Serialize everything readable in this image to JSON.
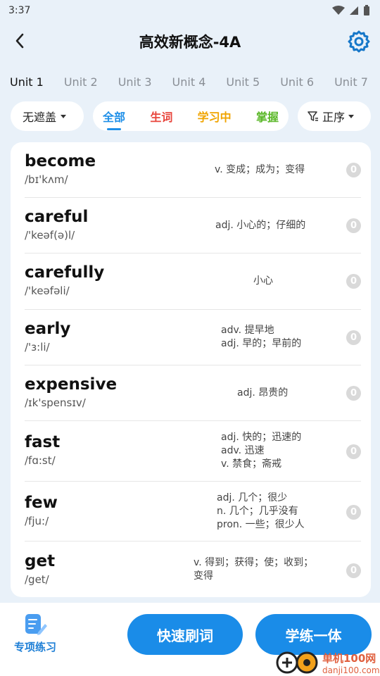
{
  "status_bar": {
    "time": "3:37"
  },
  "header": {
    "title": "高效新概念-4A"
  },
  "unit_tabs": [
    "Unit 1",
    "Unit 2",
    "Unit 3",
    "Unit 4",
    "Unit 5",
    "Unit 6",
    "Unit 7",
    "Un"
  ],
  "filters": {
    "cover_mode": "无遮盖",
    "status_tabs": {
      "all": "全部",
      "new": "生词",
      "learning": "学习中",
      "mastered": "掌握"
    },
    "order": "正序"
  },
  "words": [
    {
      "word": "become",
      "phonetic": "/bɪ'kʌm/",
      "meanings": [
        "v. 变成；成为；变得"
      ],
      "count": "0"
    },
    {
      "word": "careful",
      "phonetic": "/'keəf(ə)l/",
      "meanings": [
        "adj. 小心的；仔细的"
      ],
      "count": "0"
    },
    {
      "word": "carefully",
      "phonetic": "/'keəfəli/",
      "meanings": [
        "小心"
      ],
      "count": "0"
    },
    {
      "word": "early",
      "phonetic": "/'ɜ:li/",
      "meanings": [
        "adv. 提早地",
        "adj. 早的；早前的"
      ],
      "count": "0"
    },
    {
      "word": "expensive",
      "phonetic": "/ɪk'spensɪv/",
      "meanings": [
        "adj. 昂贵的"
      ],
      "count": "0"
    },
    {
      "word": "fast",
      "phonetic": "/fɑ:st/",
      "meanings": [
        "adj. 快的；迅速的",
        "adv. 迅速",
        "v. 禁食；斋戒"
      ],
      "count": "0"
    },
    {
      "word": "few",
      "phonetic": "/fju:/",
      "meanings": [
        "adj. 几个；很少",
        "n. 几个；几乎没有",
        "pron. 一些；很少人"
      ],
      "count": "0"
    },
    {
      "word": "get",
      "phonetic": "/get/",
      "meanings": [
        "v. 得到；获得；使；收到；",
        "变得"
      ],
      "count": "0"
    }
  ],
  "bottom": {
    "special_practice": "专项练习",
    "quick_review": "快速刷词",
    "learn_practice": "学练一体"
  },
  "watermark": {
    "cn": "单机100网",
    "en": "danji100.com"
  },
  "colors": {
    "primary": "#1a8ce8",
    "new": "#e8453c",
    "learning": "#f0a400",
    "mastered": "#5cb82a"
  }
}
